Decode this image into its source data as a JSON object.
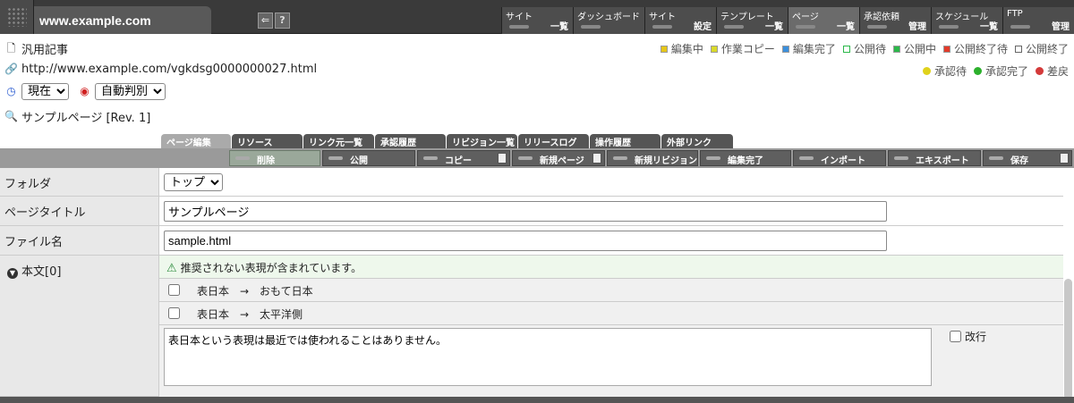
{
  "header": {
    "site_url": "www.example.com",
    "menus": [
      {
        "top": "サイト",
        "bottom": "一覧"
      },
      {
        "top": "ダッシュボード",
        "bottom": ""
      },
      {
        "top": "サイト",
        "bottom": "設定"
      },
      {
        "top": "テンプレート",
        "bottom": "一覧"
      },
      {
        "top": "ページ",
        "bottom": "一覧"
      },
      {
        "top": "承認依頼",
        "bottom": "管理"
      },
      {
        "top": "スケジュール",
        "bottom": "一覧"
      },
      {
        "top": "FTP",
        "bottom": "管理"
      }
    ],
    "icons": {
      "back": "⇐",
      "help": "?"
    }
  },
  "info": {
    "page_type": "汎用記事",
    "url": "http://www.example.com/vgkdsg0000000027.html",
    "time_select": "現在",
    "mode_select": "自動判別",
    "page_name": "サンプルページ [Rev. 1]"
  },
  "legend_status": [
    {
      "label": "編集中",
      "color": "#e6c619"
    },
    {
      "label": "作業コピー",
      "color": "#d9d92a"
    },
    {
      "label": "編集完了",
      "color": "#3b8fdc"
    },
    {
      "label": "公開待",
      "color": "#ffffff"
    },
    {
      "label": "公開中",
      "color": "#2bb84a"
    },
    {
      "label": "公開終了待",
      "color": "#e23a2a"
    },
    {
      "label": "公開終了",
      "color": "#ffffff"
    }
  ],
  "legend_approval": [
    {
      "label": "承認待",
      "color": "#e0d21c"
    },
    {
      "label": "承認完了",
      "color": "#2cb02c"
    },
    {
      "label": "差戻",
      "color": "#d43a3a"
    }
  ],
  "tabs": [
    "ページ編集",
    "リソース",
    "リンク元一覧",
    "承認履歴",
    "リビジョン一覧",
    "リリースログ",
    "操作履歴",
    "外部リンク"
  ],
  "toolbar": [
    "削除",
    "公開",
    "コピー",
    "新規ページ",
    "新規リビジョン",
    "編集完了",
    "インポート",
    "エキスポート",
    "保存"
  ],
  "form": {
    "folder_label": "フォルダ",
    "folder_value": "トップ",
    "title_label": "ページタイトル",
    "title_value": "サンプルページ",
    "file_label": "ファイル名",
    "file_value": "sample.html",
    "body_label": "本文[0]",
    "warning": "推奨されない表現が含まれています。",
    "replacements": [
      "表日本　→　おもて日本",
      "表日本　→　太平洋側"
    ],
    "body_text": "表日本という表現は最近では使われることはありません。",
    "linebreak_label": "改行"
  }
}
